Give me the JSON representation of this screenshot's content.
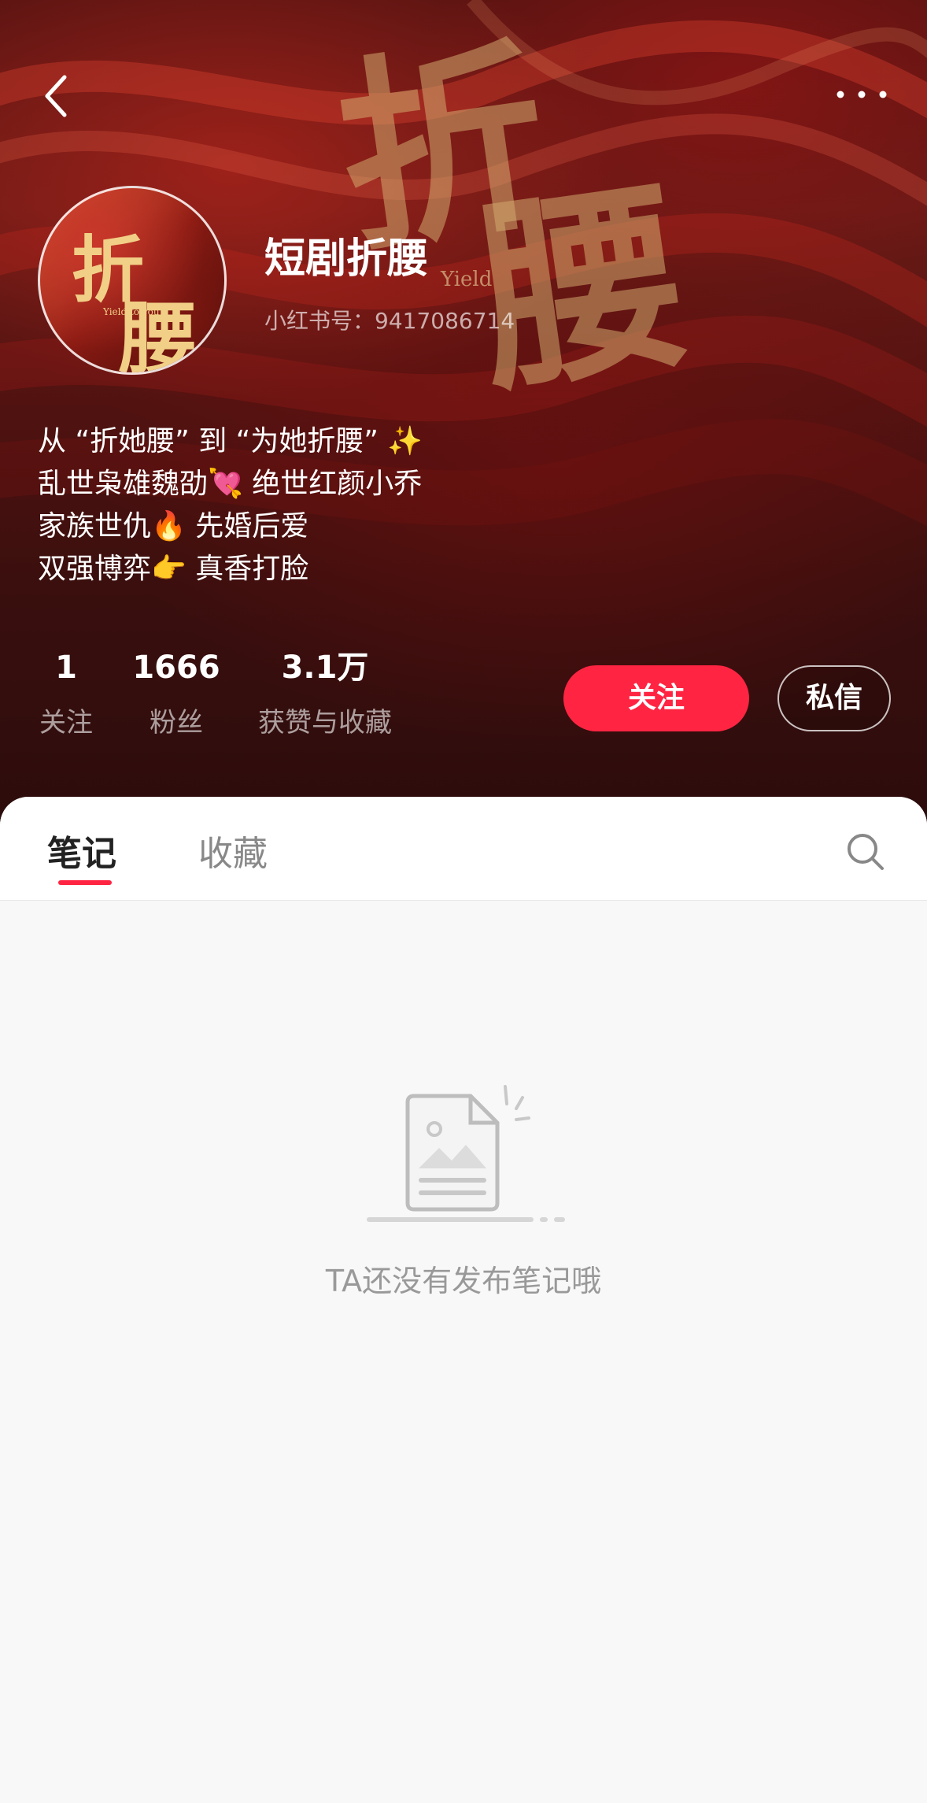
{
  "profile": {
    "name": "短剧折腰",
    "uid": "小红书号：9417086714",
    "bio": [
      "从 “折她腰” 到 “为她折腰” ✨",
      "乱世枭雄魏劭💘 绝世红颜小乔",
      "家族世仇🔥 先婚后爱",
      "双强博弈👉 真香打脸"
    ],
    "avatar_text": {
      "char1": "折",
      "char2": "腰",
      "sub": "Yield to you"
    }
  },
  "hero": {
    "calli1": "折",
    "calli2": "腰",
    "sub": "Yield"
  },
  "stats": {
    "following": {
      "value": "1",
      "label": "关注"
    },
    "fans": {
      "value": "1666",
      "label": "粉丝"
    },
    "likes": {
      "value": "3.1万",
      "label": "获赞与收藏"
    }
  },
  "actions": {
    "follow": "关注",
    "message": "私信"
  },
  "tabs": {
    "notes": "笔记",
    "collect": "收藏"
  },
  "empty": {
    "text": "TA还没有发布笔记哦"
  },
  "colors": {
    "accent": "#ff2442",
    "hero_dark": "#2c0c0c"
  },
  "icons": [
    "back-icon",
    "more-icon",
    "search-icon",
    "empty-document-icon"
  ]
}
